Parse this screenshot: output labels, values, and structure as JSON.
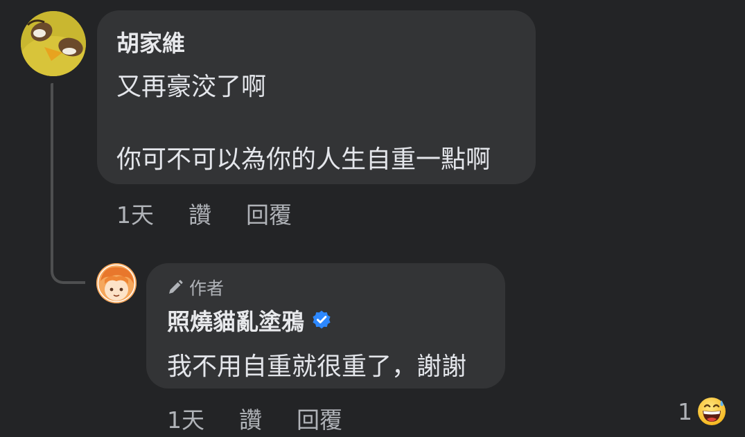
{
  "comments": [
    {
      "author": "胡家維",
      "lines": [
        "又再豪洨了啊",
        "你可不可以為你的人生自重一點啊"
      ],
      "time": "1天",
      "like_label": "讚",
      "reply_label": "回覆"
    },
    {
      "badge": "作者",
      "author": "照燒貓亂塗鴉",
      "text": "我不用自重就很重了，謝謝",
      "time": "1天",
      "like_label": "讚",
      "reply_label": "回覆",
      "reaction_count": "1",
      "reaction_icon": "grinning-sweat-emoji"
    }
  ],
  "colors": {
    "background": "#232426",
    "bubble": "#333436",
    "text": "#e4e6eb",
    "secondary_text": "#b0b3b8",
    "verified": "#2d88ff"
  }
}
